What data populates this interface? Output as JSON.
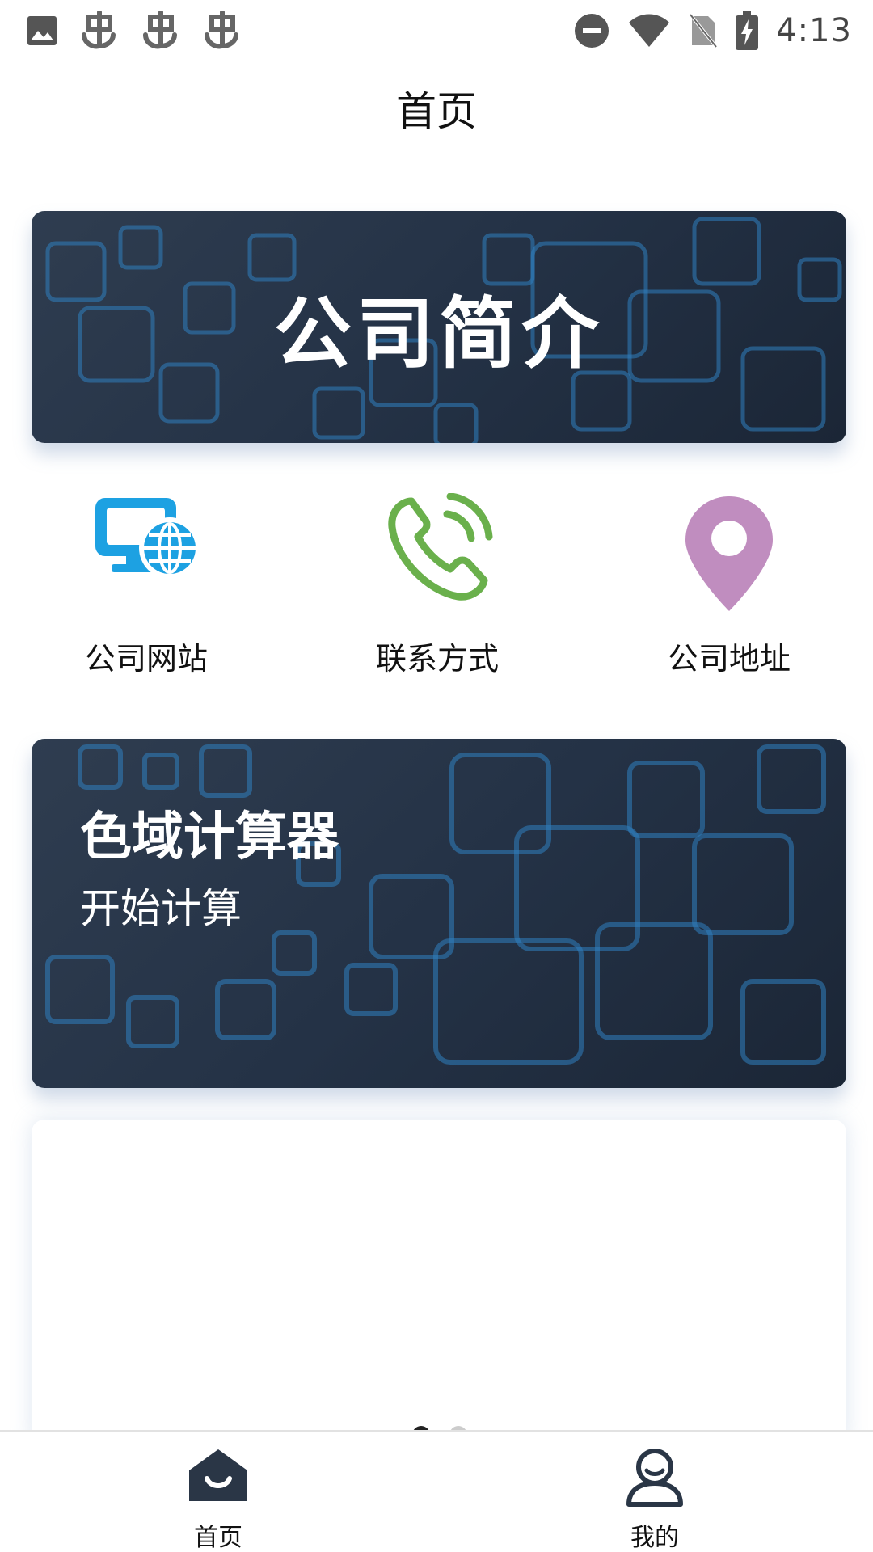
{
  "status_bar": {
    "time": "4:13",
    "left_icons": [
      "image-icon",
      "bug-icon",
      "bug-icon",
      "bug-icon"
    ],
    "right_icons": [
      "dnd-icon",
      "wifi-icon",
      "no-sim-icon",
      "battery-charging-icon"
    ]
  },
  "header": {
    "title": "首页"
  },
  "banner": {
    "title": "公司简介"
  },
  "quick_links": [
    {
      "label": "公司网站",
      "icon": "website-icon",
      "color": "#1da1e2"
    },
    {
      "label": "联系方式",
      "icon": "phone-icon",
      "color": "#6ab04c"
    },
    {
      "label": "公司地址",
      "icon": "location-pin-icon",
      "color": "#c08dbf"
    }
  ],
  "calculator_card": {
    "title": "色域计算器",
    "subtitle": "开始计算"
  },
  "carousel": {
    "dots": 2,
    "active_index": 0
  },
  "bottom_nav": {
    "items": [
      {
        "label": "首页",
        "icon": "home-icon",
        "active": true
      },
      {
        "label": "我的",
        "icon": "user-icon",
        "active": false
      }
    ]
  },
  "colors": {
    "card_bg": "#263448",
    "pattern": "#2f7fc0",
    "icon_dark": "#2a3646"
  }
}
